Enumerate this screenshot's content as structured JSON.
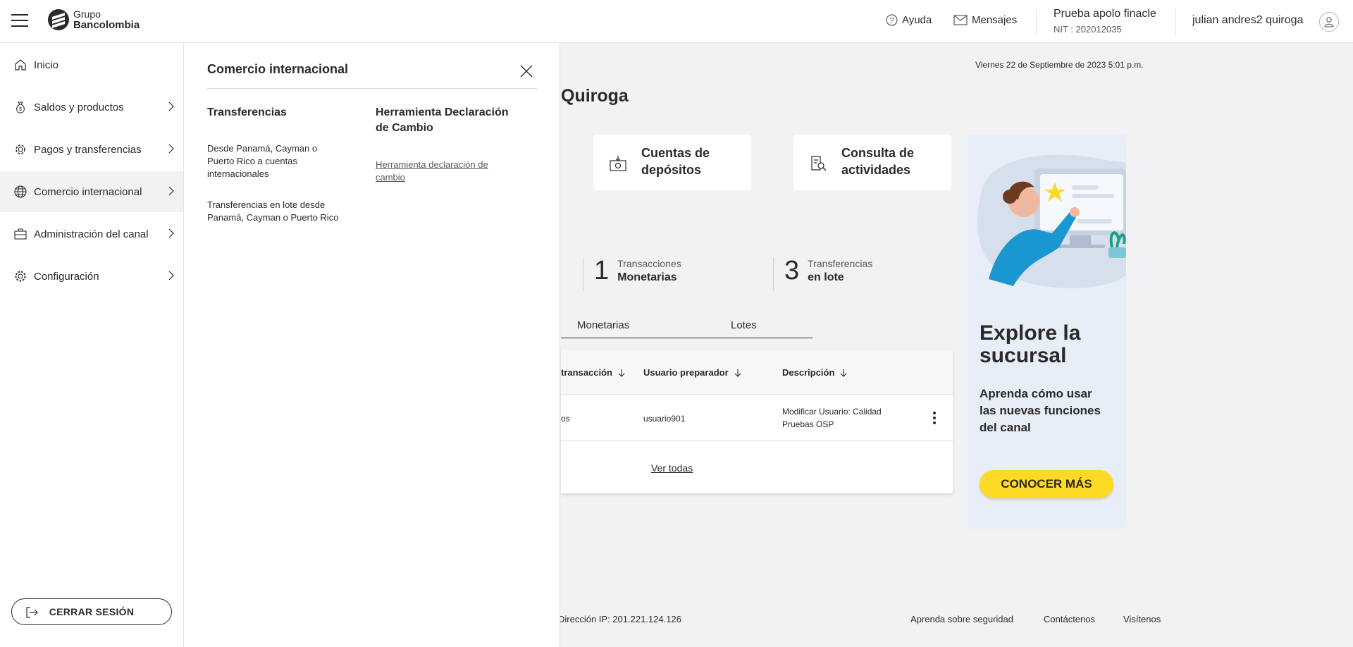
{
  "header": {
    "logo_line1": "Grupo",
    "logo_line2": "Bancolombia",
    "help_label": "Ayuda",
    "messages_label": "Mensajes",
    "company_name": "Prueba apolo finacle",
    "company_nit": "NIT : 202012035",
    "user_name": "julian andres2 quiroga"
  },
  "sidebar": {
    "items": [
      {
        "label": "Inicio",
        "icon": "home-icon"
      },
      {
        "label": "Saldos y productos",
        "icon": "money-bag-icon"
      },
      {
        "label": "Pagos y transferencias",
        "icon": "payments-gear-icon"
      },
      {
        "label": "Comercio internacional",
        "icon": "globe-icon"
      },
      {
        "label": "Administración del canal",
        "icon": "briefcase-icon"
      },
      {
        "label": "Configuración",
        "icon": "gear-icon"
      }
    ],
    "logout_label": "CERRAR SESIÓN"
  },
  "flyout": {
    "title": "Comercio internacional",
    "col1_heading": "Transferencias",
    "col1_links": [
      "Desde Panamá, Cayman o Puerto Rico a cuentas internacionales",
      "Transferencias en lote desde Panamá, Cayman o Puerto Rico"
    ],
    "col2_heading": "Herramienta Declaración de Cambio",
    "col2_links": [
      "Herramienta declaración de cambio"
    ]
  },
  "main": {
    "datetime": "Viernes 22 de Septiembre de 2023 5:01 p.m.",
    "greeting": "Quiroga",
    "quick_cards": [
      {
        "label": "Cuentas de depósitos",
        "icon": "deposit-icon"
      },
      {
        "label": "Consulta de actividades",
        "icon": "activity-search-icon"
      }
    ],
    "counters": [
      {
        "num": "1",
        "line1": "Transacciones",
        "line2": "Monetarias"
      },
      {
        "num": "3",
        "line1": "Transferencias",
        "line2": "en lote"
      }
    ],
    "tabs": [
      "Monetarias",
      "Lotes"
    ],
    "table": {
      "headers": [
        "transacción",
        "Usuario preparador",
        "Descripción"
      ],
      "row": {
        "col1": "os",
        "user": "usuario901",
        "desc": "Modificar Usuario: Calidad Pruebas OSP"
      },
      "see_all": "Ver todas"
    }
  },
  "promo": {
    "title": "Explore la sucursal",
    "subtitle": "Aprenda cómo usar las nuevas funciones del canal",
    "button": "CONOCER MÁS",
    "accent": "#fdda24"
  },
  "footer": {
    "ip": "Dirección IP: 201.221.124.126",
    "links": [
      "Aprenda sobre seguridad",
      "Contáctenos",
      "Visítenos"
    ]
  }
}
